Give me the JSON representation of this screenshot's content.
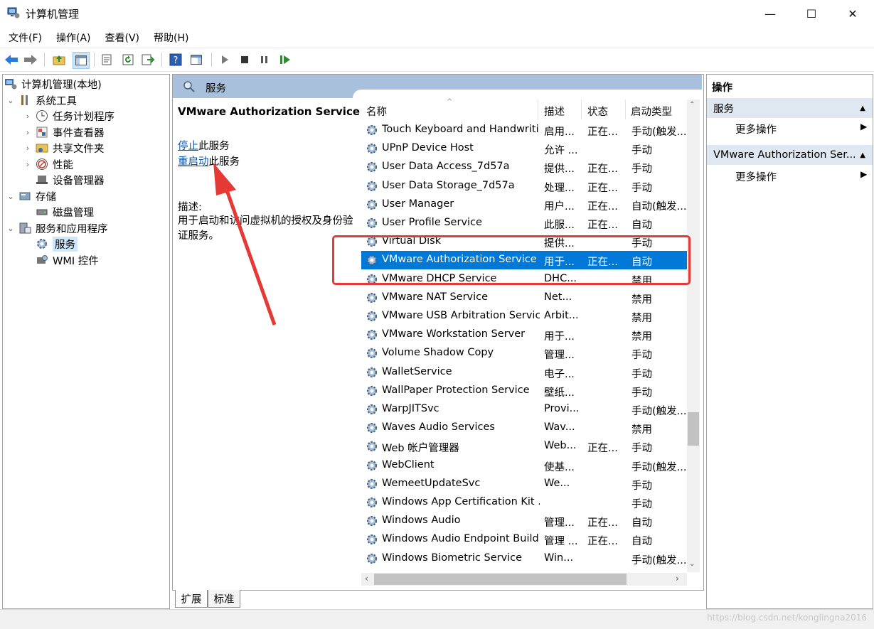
{
  "window": {
    "title": "计算机管理",
    "minimize": "—",
    "maximize": "☐",
    "close": "✕"
  },
  "menu": [
    "文件(F)",
    "操作(A)",
    "查看(V)",
    "帮助(H)"
  ],
  "tree": {
    "root": "计算机管理(本地)",
    "system_tools": "系统工具",
    "task_scheduler": "任务计划程序",
    "event_viewer": "事件查看器",
    "shared_folders": "共享文件夹",
    "performance": "性能",
    "device_manager": "设备管理器",
    "storage": "存储",
    "disk_management": "磁盘管理",
    "services_apps": "服务和应用程序",
    "services": "服务",
    "wmi": "WMI 控件"
  },
  "pane_header": "服务",
  "detail": {
    "service_name": "VMware Authorization Service",
    "stop_link": "停止",
    "stop_suffix": "此服务",
    "restart_link": "重启动",
    "restart_suffix": "此服务",
    "desc_label": "描述:",
    "desc_text": "用于启动和访问虚拟机的授权及身份验证服务。"
  },
  "columns": {
    "name": "名称",
    "desc": "描述",
    "status": "状态",
    "startup": "启动类型"
  },
  "services": [
    {
      "name": "Touch Keyboard and Handwriti...",
      "desc": "启用...",
      "status": "正在...",
      "startup": "手动(触发..."
    },
    {
      "name": "UPnP Device Host",
      "desc": "允许 ...",
      "status": "",
      "startup": "手动"
    },
    {
      "name": "User Data Access_7d57a",
      "desc": "提供...",
      "status": "正在...",
      "startup": "手动"
    },
    {
      "name": "User Data Storage_7d57a",
      "desc": "处理...",
      "status": "正在...",
      "startup": "手动"
    },
    {
      "name": "User Manager",
      "desc": "用户...",
      "status": "正在...",
      "startup": "自动(触发..."
    },
    {
      "name": "User Profile Service",
      "desc": "此服...",
      "status": "正在...",
      "startup": "自动"
    },
    {
      "name": "Virtual Disk",
      "desc": "提供...",
      "status": "",
      "startup": "手动"
    },
    {
      "name": "VMware Authorization Service",
      "desc": "用于...",
      "status": "正在...",
      "startup": "自动"
    },
    {
      "name": "VMware DHCP Service",
      "desc": "DHC...",
      "status": "",
      "startup": "禁用"
    },
    {
      "name": "VMware NAT Service",
      "desc": "Net...",
      "status": "",
      "startup": "禁用"
    },
    {
      "name": "VMware USB Arbitration Service",
      "desc": "Arbit...",
      "status": "",
      "startup": "禁用"
    },
    {
      "name": "VMware Workstation Server",
      "desc": "用于...",
      "status": "",
      "startup": "禁用"
    },
    {
      "name": "Volume Shadow Copy",
      "desc": "管理...",
      "status": "",
      "startup": "手动"
    },
    {
      "name": "WalletService",
      "desc": "电子...",
      "status": "",
      "startup": "手动"
    },
    {
      "name": "WallPaper Protection Service",
      "desc": "壁纸...",
      "status": "",
      "startup": "手动"
    },
    {
      "name": "WarpJITSvc",
      "desc": "Provi...",
      "status": "",
      "startup": "手动(触发..."
    },
    {
      "name": "Waves Audio Services",
      "desc": "Wav...",
      "status": "",
      "startup": "禁用"
    },
    {
      "name": "Web 帐户管理器",
      "desc": "Web...",
      "status": "正在...",
      "startup": "手动"
    },
    {
      "name": "WebClient",
      "desc": "使基...",
      "status": "",
      "startup": "手动(触发..."
    },
    {
      "name": "WemeetUpdateSvc",
      "desc": "We...",
      "status": "",
      "startup": "手动"
    },
    {
      "name": "Windows App Certification Kit ...",
      "desc": "",
      "status": "",
      "startup": "手动"
    },
    {
      "name": "Windows Audio",
      "desc": "管理...",
      "status": "正在...",
      "startup": "自动"
    },
    {
      "name": "Windows Audio Endpoint Build...",
      "desc": "管理 ...",
      "status": "正在...",
      "startup": "自动"
    },
    {
      "name": "Windows Biometric Service",
      "desc": "Win...",
      "status": "",
      "startup": "手动(触发..."
    }
  ],
  "tabs": [
    "扩展",
    "标准"
  ],
  "actions": {
    "title": "操作",
    "group1": "服务",
    "group1_more": "更多操作",
    "group2": "VMware Authorization Ser...",
    "group2_more": "更多操作"
  },
  "watermark": "https://blog.csdn.net/konglingna2016",
  "colors": {
    "selection": "#0078d7",
    "header_blue": "#a9c0dc",
    "annotation_red": "#e53935",
    "link": "#0b54a4"
  }
}
